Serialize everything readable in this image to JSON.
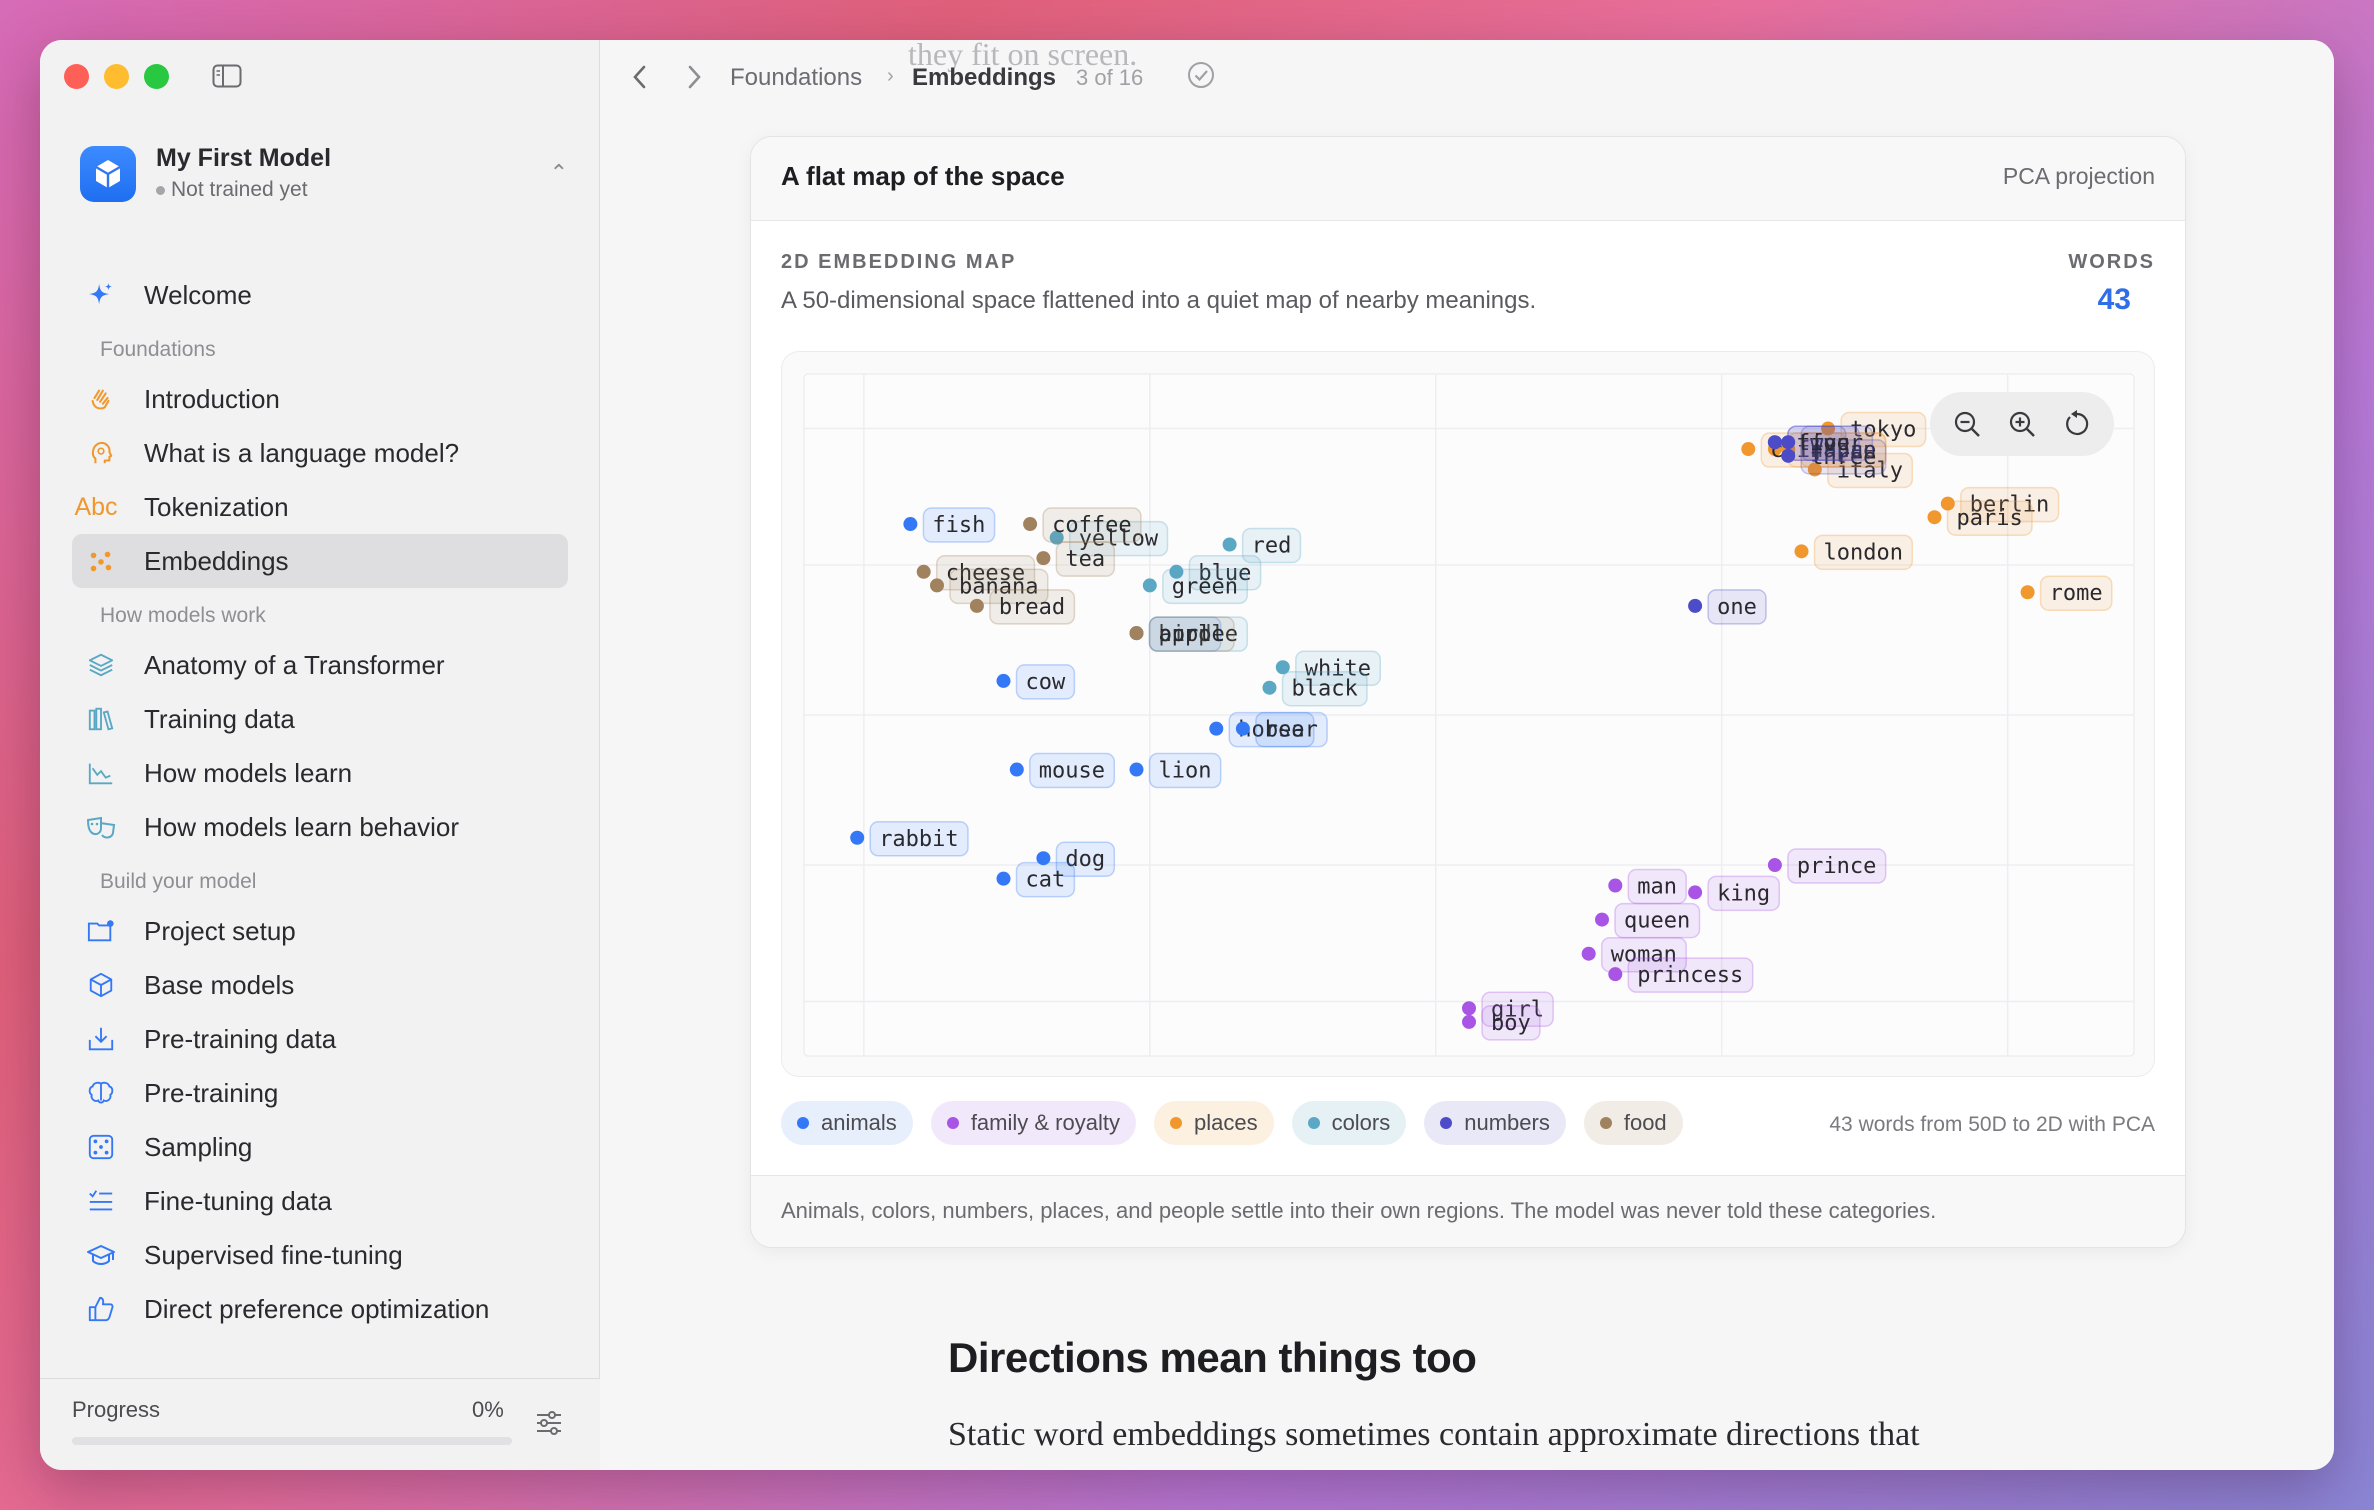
{
  "project": {
    "name": "My First Model",
    "status": "Not trained yet"
  },
  "nav": {
    "welcome": "Welcome",
    "sections": [
      {
        "title": "Foundations",
        "items": [
          "Introduction",
          "What is a language model?",
          "Tokenization",
          "Embeddings"
        ]
      },
      {
        "title": "How models work",
        "items": [
          "Anatomy of a Transformer",
          "Training data",
          "How models learn",
          "How models learn behavior"
        ]
      },
      {
        "title": "Build your model",
        "items": [
          "Project setup",
          "Base models",
          "Pre-training data",
          "Pre-training",
          "Sampling",
          "Fine-tuning data",
          "Supervised fine-tuning",
          "Direct preference optimization"
        ]
      }
    ],
    "active": "Embeddings"
  },
  "progress": {
    "label": "Progress",
    "value_text": "0%",
    "value": 0
  },
  "breadcrumb": {
    "section": "Foundations",
    "page": "Embeddings",
    "count": "3 of 16"
  },
  "ghost_text": "they fit on screen.",
  "card": {
    "title": "A flat map of the space",
    "tag": "PCA projection",
    "kicker": "2D EMBEDDING MAP",
    "subtitle": "A 50-dimensional space flattened into a quiet map of nearby meanings.",
    "count_label": "WORDS",
    "count_value": "43",
    "legend_note": "43 words from 50D to 2D with PCA",
    "footer": "Animals, colors, numbers, places, and people settle into their own regions. The model was never told these categories."
  },
  "colors": {
    "animals": "#3478f6",
    "family": "#a855e6",
    "places": "#f0982e",
    "colors": "#5aa8c4",
    "numbers": "#4d4cc8",
    "food": "#a0825e"
  },
  "chart_data": {
    "type": "scatter",
    "title": "",
    "xlabel": "",
    "ylabel": "",
    "grid": true,
    "legend": [
      "animals",
      "family & royalty",
      "places",
      "colors",
      "numbers",
      "food"
    ],
    "series": [
      {
        "name": "animals",
        "points": [
          {
            "label": "fish",
            "x": 0.08,
            "y": 0.78
          },
          {
            "label": "cow",
            "x": 0.15,
            "y": 0.55
          },
          {
            "label": "mouse",
            "x": 0.16,
            "y": 0.42
          },
          {
            "label": "lion",
            "x": 0.25,
            "y": 0.42
          },
          {
            "label": "rabbit",
            "x": 0.04,
            "y": 0.32
          },
          {
            "label": "dog",
            "x": 0.18,
            "y": 0.29
          },
          {
            "label": "cat",
            "x": 0.15,
            "y": 0.26
          },
          {
            "label": "horse",
            "x": 0.31,
            "y": 0.48
          },
          {
            "label": "bear",
            "x": 0.33,
            "y": 0.48
          },
          {
            "label": "bird",
            "x": 0.25,
            "y": 0.62
          }
        ]
      },
      {
        "name": "family & royalty",
        "points": [
          {
            "label": "prince",
            "x": 0.73,
            "y": 0.28
          },
          {
            "label": "man",
            "x": 0.61,
            "y": 0.25
          },
          {
            "label": "king",
            "x": 0.67,
            "y": 0.24
          },
          {
            "label": "queen",
            "x": 0.6,
            "y": 0.2
          },
          {
            "label": "woman",
            "x": 0.59,
            "y": 0.15
          },
          {
            "label": "princess",
            "x": 0.61,
            "y": 0.12
          },
          {
            "label": "girl",
            "x": 0.5,
            "y": 0.07
          },
          {
            "label": "boy",
            "x": 0.5,
            "y": 0.05
          }
        ]
      },
      {
        "name": "places",
        "points": [
          {
            "label": "tokyo",
            "x": 0.77,
            "y": 0.92
          },
          {
            "label": "france",
            "x": 0.73,
            "y": 0.89
          },
          {
            "label": "italy",
            "x": 0.76,
            "y": 0.86
          },
          {
            "label": "berlin",
            "x": 0.86,
            "y": 0.81
          },
          {
            "label": "paris",
            "x": 0.85,
            "y": 0.79
          },
          {
            "label": "london",
            "x": 0.75,
            "y": 0.74
          },
          {
            "label": "rome",
            "x": 0.92,
            "y": 0.68
          },
          {
            "label": "china",
            "x": 0.71,
            "y": 0.89
          },
          {
            "label": "japan",
            "x": 0.74,
            "y": 0.89
          }
        ]
      },
      {
        "name": "colors",
        "points": [
          {
            "label": "yellow",
            "x": 0.19,
            "y": 0.76
          },
          {
            "label": "red",
            "x": 0.32,
            "y": 0.75
          },
          {
            "label": "blue",
            "x": 0.28,
            "y": 0.71
          },
          {
            "label": "green",
            "x": 0.26,
            "y": 0.69
          },
          {
            "label": "white",
            "x": 0.36,
            "y": 0.57
          },
          {
            "label": "black",
            "x": 0.35,
            "y": 0.54
          },
          {
            "label": "purple",
            "x": 0.25,
            "y": 0.62
          }
        ]
      },
      {
        "name": "numbers",
        "points": [
          {
            "label": "one",
            "x": 0.67,
            "y": 0.66
          },
          {
            "label": "two",
            "x": 0.73,
            "y": 0.9
          },
          {
            "label": "three",
            "x": 0.74,
            "y": 0.88
          },
          {
            "label": "four",
            "x": 0.74,
            "y": 0.9
          },
          {
            "label": "five",
            "x": 0.73,
            "y": 0.9
          }
        ]
      },
      {
        "name": "food",
        "points": [
          {
            "label": "coffee",
            "x": 0.17,
            "y": 0.78
          },
          {
            "label": "tea",
            "x": 0.18,
            "y": 0.73
          },
          {
            "label": "cheese",
            "x": 0.09,
            "y": 0.71
          },
          {
            "label": "banana",
            "x": 0.1,
            "y": 0.69
          },
          {
            "label": "bread",
            "x": 0.13,
            "y": 0.66
          },
          {
            "label": "apple",
            "x": 0.25,
            "y": 0.62
          }
        ]
      }
    ]
  },
  "article": {
    "heading": "Directions mean things too",
    "paragraph": "Static word embeddings sometimes contain approximate directions that"
  }
}
